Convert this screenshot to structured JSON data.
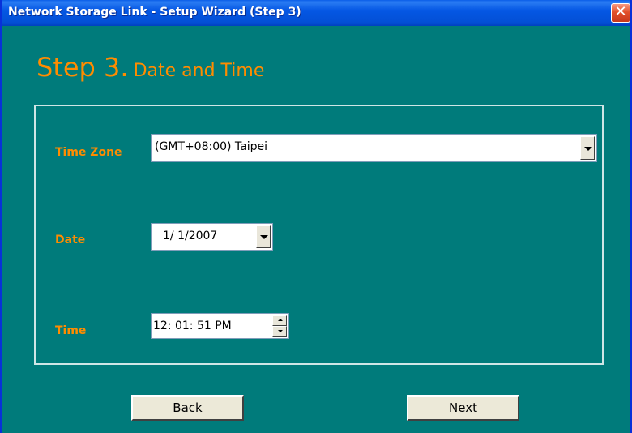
{
  "window": {
    "title": "Network Storage Link - Setup Wizard (Step 3)",
    "close_glyph": "✕"
  },
  "heading": {
    "step": "Step 3.",
    "subtitle": "Date and Time"
  },
  "form": {
    "time_zone_label": "Time Zone",
    "time_zone_value": "(GMT+08:00) Taipei",
    "date_label": "Date",
    "date_value": "1/ 1/2007",
    "time_label": "Time",
    "time_value": "12: 01: 51 PM"
  },
  "buttons": {
    "back": "Back",
    "next": "Next"
  },
  "colors": {
    "background": "#007b7b",
    "accent": "#ff8c00",
    "titlebar": "#0350d6"
  }
}
